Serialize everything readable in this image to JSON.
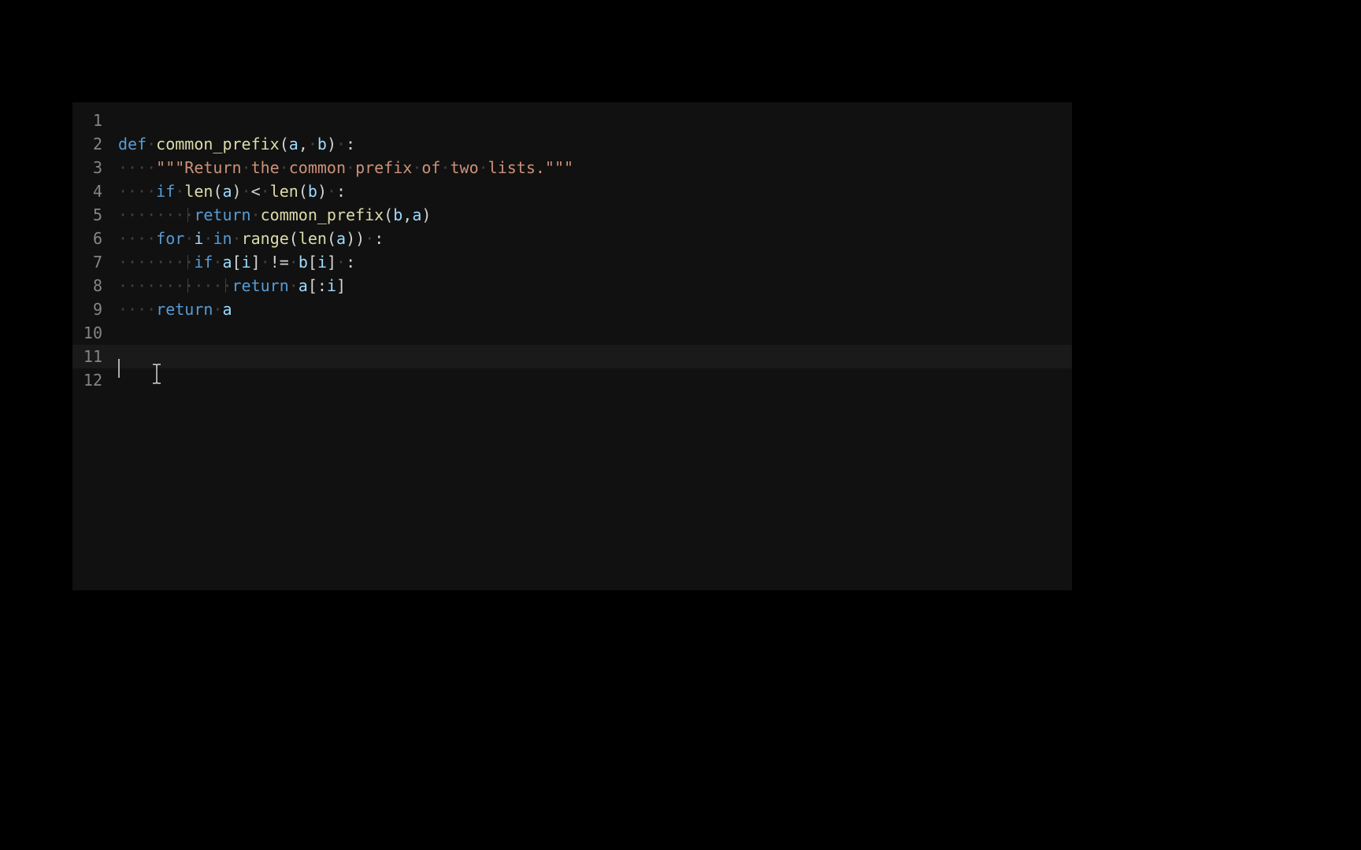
{
  "editor": {
    "lines": [
      {
        "num": "1",
        "tokens": []
      },
      {
        "num": "2",
        "tokens": [
          {
            "cls": "kw",
            "t": "def"
          },
          {
            "cls": "ws-dot",
            "t": "·"
          },
          {
            "cls": "fn",
            "t": "common_prefix"
          },
          {
            "cls": "punct",
            "t": "("
          },
          {
            "cls": "param",
            "t": "a"
          },
          {
            "cls": "punct",
            "t": ","
          },
          {
            "cls": "ws-dot",
            "t": "·"
          },
          {
            "cls": "param",
            "t": "b"
          },
          {
            "cls": "punct",
            "t": ")"
          },
          {
            "cls": "ws-dot",
            "t": "·"
          },
          {
            "cls": "punct",
            "t": ":"
          }
        ]
      },
      {
        "num": "3",
        "tokens": [
          {
            "cls": "ws-dot",
            "t": "····"
          },
          {
            "cls": "str",
            "t": "\"\"\"Return"
          },
          {
            "cls": "ws-dot",
            "t": "·"
          },
          {
            "cls": "str",
            "t": "the"
          },
          {
            "cls": "ws-dot",
            "t": "·"
          },
          {
            "cls": "str",
            "t": "common"
          },
          {
            "cls": "ws-dot",
            "t": "·"
          },
          {
            "cls": "str",
            "t": "prefix"
          },
          {
            "cls": "ws-dot",
            "t": "·"
          },
          {
            "cls": "str",
            "t": "of"
          },
          {
            "cls": "ws-dot",
            "t": "·"
          },
          {
            "cls": "str",
            "t": "two"
          },
          {
            "cls": "ws-dot",
            "t": "·"
          },
          {
            "cls": "str",
            "t": "lists.\"\"\""
          }
        ]
      },
      {
        "num": "4",
        "tokens": [
          {
            "cls": "ws-dot",
            "t": "····"
          },
          {
            "cls": "kw",
            "t": "if"
          },
          {
            "cls": "ws-dot",
            "t": "·"
          },
          {
            "cls": "builtin",
            "t": "len"
          },
          {
            "cls": "punct",
            "t": "("
          },
          {
            "cls": "var",
            "t": "a"
          },
          {
            "cls": "punct",
            "t": ")"
          },
          {
            "cls": "ws-dot",
            "t": "·"
          },
          {
            "cls": "op",
            "t": "<"
          },
          {
            "cls": "ws-dot",
            "t": "·"
          },
          {
            "cls": "builtin",
            "t": "len"
          },
          {
            "cls": "punct",
            "t": "("
          },
          {
            "cls": "var",
            "t": "b"
          },
          {
            "cls": "punct",
            "t": ")"
          },
          {
            "cls": "ws-dot",
            "t": "·"
          },
          {
            "cls": "punct",
            "t": ":"
          }
        ]
      },
      {
        "num": "5",
        "tokens": [
          {
            "cls": "ws-dot",
            "t": "········"
          },
          {
            "cls": "kw",
            "t": "return"
          },
          {
            "cls": "ws-dot",
            "t": "·"
          },
          {
            "cls": "fn",
            "t": "common_prefix"
          },
          {
            "cls": "punct",
            "t": "("
          },
          {
            "cls": "var",
            "t": "b"
          },
          {
            "cls": "punct",
            "t": ","
          },
          {
            "cls": "var",
            "t": "a"
          },
          {
            "cls": "punct",
            "t": ")"
          }
        ]
      },
      {
        "num": "6",
        "tokens": [
          {
            "cls": "ws-dot",
            "t": "····"
          },
          {
            "cls": "kw",
            "t": "for"
          },
          {
            "cls": "ws-dot",
            "t": "·"
          },
          {
            "cls": "var",
            "t": "i"
          },
          {
            "cls": "ws-dot",
            "t": "·"
          },
          {
            "cls": "kw",
            "t": "in"
          },
          {
            "cls": "ws-dot",
            "t": "·"
          },
          {
            "cls": "builtin",
            "t": "range"
          },
          {
            "cls": "punct",
            "t": "("
          },
          {
            "cls": "builtin",
            "t": "len"
          },
          {
            "cls": "punct",
            "t": "("
          },
          {
            "cls": "var",
            "t": "a"
          },
          {
            "cls": "punct",
            "t": "))"
          },
          {
            "cls": "ws-dot",
            "t": "·"
          },
          {
            "cls": "punct",
            "t": ":"
          }
        ]
      },
      {
        "num": "7",
        "tokens": [
          {
            "cls": "ws-dot",
            "t": "········"
          },
          {
            "cls": "kw",
            "t": "if"
          },
          {
            "cls": "ws-dot",
            "t": "·"
          },
          {
            "cls": "var",
            "t": "a"
          },
          {
            "cls": "punct",
            "t": "["
          },
          {
            "cls": "var",
            "t": "i"
          },
          {
            "cls": "punct",
            "t": "]"
          },
          {
            "cls": "ws-dot",
            "t": "·"
          },
          {
            "cls": "op",
            "t": "!="
          },
          {
            "cls": "ws-dot",
            "t": "·"
          },
          {
            "cls": "var",
            "t": "b"
          },
          {
            "cls": "punct",
            "t": "["
          },
          {
            "cls": "var",
            "t": "i"
          },
          {
            "cls": "punct",
            "t": "]"
          },
          {
            "cls": "ws-dot",
            "t": "·"
          },
          {
            "cls": "punct",
            "t": ":"
          }
        ]
      },
      {
        "num": "8",
        "tokens": [
          {
            "cls": "ws-dot",
            "t": "············"
          },
          {
            "cls": "kw",
            "t": "return"
          },
          {
            "cls": "ws-dot",
            "t": "·"
          },
          {
            "cls": "var",
            "t": "a"
          },
          {
            "cls": "punct",
            "t": "[:"
          },
          {
            "cls": "var",
            "t": "i"
          },
          {
            "cls": "punct",
            "t": "]"
          }
        ]
      },
      {
        "num": "9",
        "tokens": [
          {
            "cls": "ws-dot",
            "t": "····"
          },
          {
            "cls": "kw",
            "t": "return"
          },
          {
            "cls": "ws-dot",
            "t": "·"
          },
          {
            "cls": "var",
            "t": "a"
          }
        ]
      },
      {
        "num": "10",
        "tokens": []
      },
      {
        "num": "11",
        "tokens": [],
        "current": true
      },
      {
        "num": "12",
        "tokens": []
      }
    ]
  }
}
